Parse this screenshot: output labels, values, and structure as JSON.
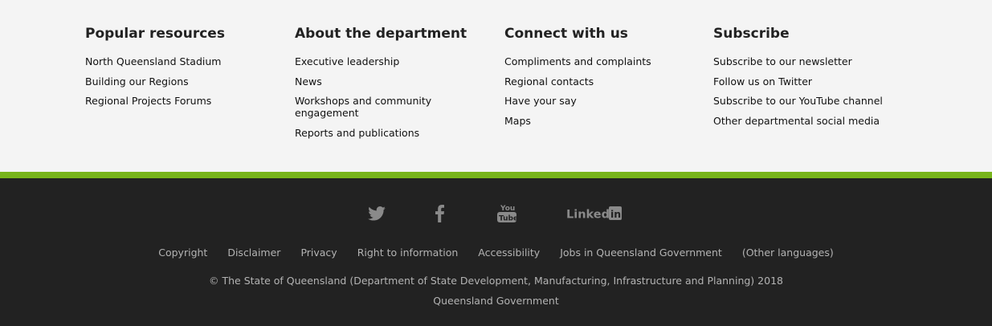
{
  "columns": [
    {
      "heading": "Popular resources",
      "links": [
        "North Queensland Stadium",
        "Building our Regions",
        "Regional Projects Forums"
      ]
    },
    {
      "heading": "About the department",
      "links": [
        "Executive leadership",
        "News",
        "Workshops and community engagement",
        "Reports and publications"
      ]
    },
    {
      "heading": "Connect with us",
      "links": [
        "Compliments and complaints",
        "Regional contacts",
        "Have your say",
        "Maps"
      ]
    },
    {
      "heading": "Subscribe",
      "links": [
        "Subscribe to our newsletter",
        "Follow us on Twitter",
        "Subscribe to our YouTube channel",
        "Other departmental social media"
      ]
    }
  ],
  "social": {
    "icons": [
      "twitter-icon",
      "facebook-icon",
      "youtube-icon",
      "linkedin-icon"
    ]
  },
  "footer_links": [
    "Copyright",
    "Disclaimer",
    "Privacy",
    "Right to information",
    "Accessibility",
    "Jobs in Queensland Government",
    "(Other languages)"
  ],
  "copyright": "© The State of Queensland (Department of State Development, Manufacturing, Infrastructure and Planning) 2018",
  "government": "Queensland Government",
  "colors": {
    "top_bg": "#f4f4f4",
    "accent_stripe": "#78b41c",
    "bottom_bg": "#222222",
    "footer_text": "#b3b3b3"
  }
}
